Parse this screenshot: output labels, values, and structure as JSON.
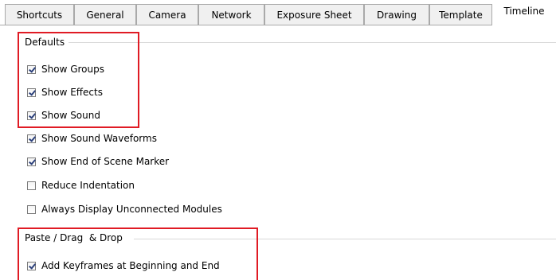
{
  "tabs": [
    "Shortcuts",
    "General",
    "Camera",
    "Network",
    "Exposure Sheet",
    "Drawing",
    "Template",
    "Timeline"
  ],
  "active_tab": "Timeline",
  "defaults": {
    "title": "Defaults",
    "items": [
      {
        "label": "Show Groups",
        "checked": true
      },
      {
        "label": "Show Effects",
        "checked": true
      },
      {
        "label": "Show Sound",
        "checked": true
      },
      {
        "label": "Show Sound Waveforms",
        "checked": true
      },
      {
        "label": "Show End of Scene Marker",
        "checked": true
      },
      {
        "label": "Reduce Indentation",
        "checked": false
      },
      {
        "label": "Always Display Unconnected Modules",
        "checked": false
      }
    ]
  },
  "paste": {
    "title": "Paste / Drag  & Drop",
    "items": [
      {
        "label": "Add Keyframes at Beginning and End",
        "checked": true
      }
    ]
  },
  "colors": {
    "highlight": "#e01b24",
    "check": "#2a3f7a",
    "tab_border": "#a9a9a9"
  }
}
